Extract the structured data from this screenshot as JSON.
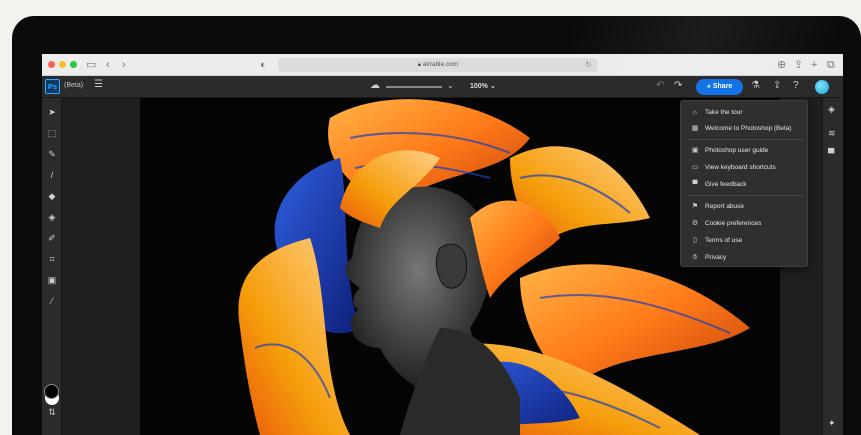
{
  "browser": {
    "url": "airtable.com",
    "colors": {
      "close": "#ff5f57",
      "minimize": "#febc2e",
      "zoom": "#28c840"
    }
  },
  "app": {
    "logo": "Ps",
    "beta_label": "(Beta)",
    "zoom_level": "100%",
    "share_label": "Share",
    "accent": "#1473e6"
  },
  "menu": {
    "items": [
      {
        "icon": "tour-icon",
        "label": "Take the tour"
      },
      {
        "icon": "gift-icon",
        "label": "Welcome to Photoshop (Beta)"
      },
      {
        "icon": "ps-guide-icon",
        "label": "Photoshop user guide"
      },
      {
        "icon": "keyboard-icon",
        "label": "View keyboard shortcuts"
      },
      {
        "icon": "feedback-icon",
        "label": "Give feedback"
      },
      {
        "icon": "flag-icon",
        "label": "Report abuse"
      },
      {
        "icon": "cookie-settings-icon",
        "label": "Cookie preferences"
      },
      {
        "icon": "document-icon",
        "label": "Terms of use"
      },
      {
        "icon": "hand-icon",
        "label": "Privacy"
      }
    ]
  }
}
